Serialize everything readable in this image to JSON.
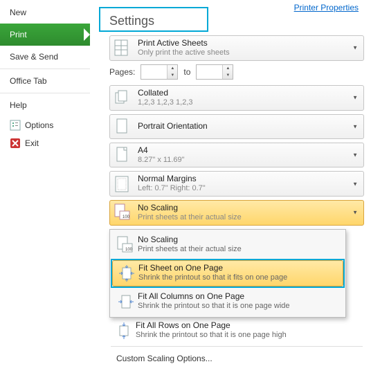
{
  "sidebar": {
    "items": [
      {
        "label": "New"
      },
      {
        "label": "Print"
      },
      {
        "label": "Save & Send"
      },
      {
        "label": "Office Tab"
      },
      {
        "label": "Help"
      }
    ],
    "options_label": "Options",
    "exit_label": "Exit"
  },
  "header": {
    "printer_properties": "Printer Properties",
    "settings": "Settings"
  },
  "pages": {
    "label": "Pages:",
    "to_label": "to",
    "from": "",
    "to": ""
  },
  "print_what": {
    "title": "Print Active Sheets",
    "sub": "Only print the active sheets"
  },
  "collate": {
    "title": "Collated",
    "sub": "1,2,3    1,2,3    1,2,3"
  },
  "orientation": {
    "title": "Portrait Orientation"
  },
  "paper": {
    "title": "A4",
    "sub": "8.27\" x 11.69\""
  },
  "margins": {
    "title": "Normal Margins",
    "sub": "Left:  0.7\"    Right:  0.7\""
  },
  "scaling": {
    "title": "No Scaling",
    "sub": "Print sheets at their actual size"
  },
  "scaling_menu": {
    "items": [
      {
        "title": "No Scaling",
        "sub": "Print sheets at their actual size"
      },
      {
        "title": "Fit Sheet on One Page",
        "sub": "Shrink the printout so that it fits on one page"
      },
      {
        "title": "Fit All Columns on One Page",
        "sub": "Shrink the printout so that it is one page wide"
      },
      {
        "title": "Fit All Rows on One Page",
        "sub": "Shrink the printout so that it is one page high"
      }
    ],
    "footer": "Custom Scaling Options..."
  }
}
